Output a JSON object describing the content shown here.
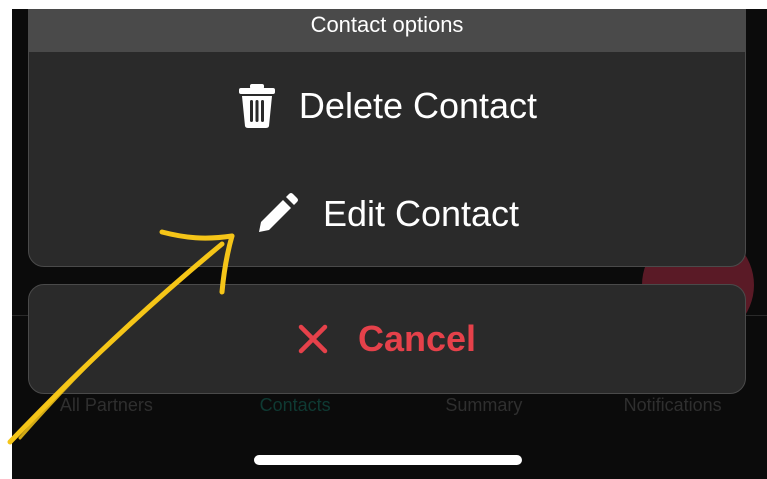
{
  "sheet": {
    "title": "Contact options",
    "items": [
      {
        "label": "Delete Contact",
        "icon": "trash-icon"
      },
      {
        "label": "Edit Contact",
        "icon": "pencil-icon"
      }
    ],
    "cancel": {
      "label": "Cancel",
      "icon": "close-icon",
      "color": "#e5414a"
    }
  },
  "tabbar": {
    "tabs": [
      "All Partners",
      "Contacts",
      "Summary",
      "Notifications"
    ],
    "active": "Contacts"
  },
  "annotation": {
    "type": "hand-drawn-arrow",
    "color": "#f5c518",
    "points_to": "Edit Contact"
  }
}
